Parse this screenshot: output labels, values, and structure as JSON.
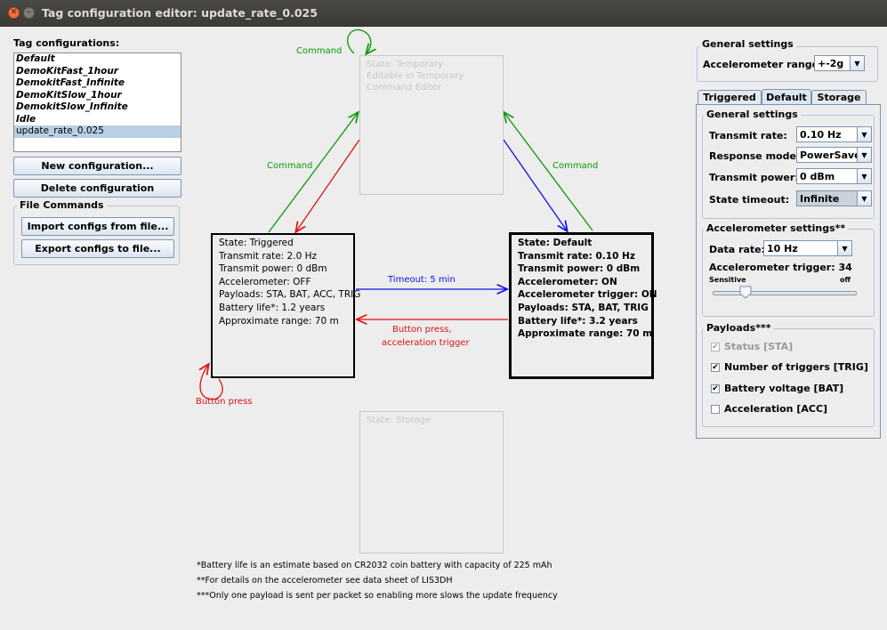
{
  "window": {
    "title": "Tag configuration editor: update_rate_0.025"
  },
  "left": {
    "list_label": "Tag configurations:",
    "configs": [
      "Default",
      "DemoKitFast_1hour",
      "DemokitFast_Infinite",
      "DemoKitSlow_1hour",
      "DemokitSlow_Infinite",
      "Idle",
      "update_rate_0.025"
    ],
    "selected_index": 6,
    "new_button": "New configuration...",
    "delete_button": "Delete configuration",
    "file_group": "File Commands",
    "import_button": "Import configs from file...",
    "export_button": "Export configs to file..."
  },
  "diagram": {
    "temporary": {
      "lines": [
        "State: Temporary",
        "Editable in Temporary",
        "Command Editor"
      ]
    },
    "triggered": {
      "lines": [
        "State: Triggered",
        "Transmit rate: 2.0 Hz",
        "Transmit power: 0 dBm",
        "Accelerometer: OFF",
        "Payloads: STA, BAT, ACC, TRIG",
        "Battery life*: 1.2 years",
        "Approximate range: 70 m"
      ]
    },
    "default": {
      "lines": [
        "State: Default",
        "Transmit rate: 0.10 Hz",
        "Transmit power: 0 dBm",
        "Accelerometer: ON",
        "Accelerometer trigger: ON",
        "Payloads: STA, BAT, TRIG",
        "Battery life*: 3.2 years",
        "Approximate range: 70 m"
      ]
    },
    "storage": {
      "lines": [
        "State: Storage"
      ]
    },
    "labels": {
      "command_top": "Command",
      "command_left": "Command",
      "command_right": "Command",
      "timeout": "Timeout: 5 min",
      "button_accel_1": "Button press,",
      "button_accel_2": "acceleration trigger",
      "button_press": "Button press"
    },
    "colors": {
      "command": "#0a9a0a",
      "button": "#e01010",
      "timeout": "#1010e8"
    }
  },
  "footnotes": [
    "*Battery life is an estimate based on CR2032 coin battery with capacity of 225 mAh",
    "**For details on the accelerometer see data sheet of LIS3DH",
    "***Only one payload is sent per packet so enabling more slows the update frequency"
  ],
  "right": {
    "general_title": "General settings",
    "accel_range_label": "Accelerometer range:",
    "accel_range_value": "+-2g",
    "tabs": [
      "Triggered",
      "Default",
      "Storage"
    ],
    "active_tab": "Default",
    "state_general_title": "General settings",
    "transmit_rate_label": "Transmit rate:",
    "transmit_rate_value": "0.10 Hz",
    "response_mode_label": "Response mode:",
    "response_mode_value": "PowerSave",
    "transmit_power_label": "Transmit power:",
    "transmit_power_value": "0 dBm",
    "state_timeout_label": "State timeout:",
    "state_timeout_value": "Infinite",
    "accel_settings_title": "Accelerometer settings**",
    "data_rate_label": "Data rate:",
    "data_rate_value": "10 Hz",
    "accel_trigger_label": "Accelerometer trigger: 34",
    "slider_left": "Sensitive",
    "slider_right": "off",
    "slider_fraction": 0.2,
    "payloads_title": "Payloads***",
    "payloads": [
      {
        "label": "Status [STA]",
        "checked": true,
        "enabled": false
      },
      {
        "label": "Number of triggers [TRIG]",
        "checked": true,
        "enabled": true
      },
      {
        "label": "Battery voltage [BAT]",
        "checked": true,
        "enabled": true
      },
      {
        "label": "Acceleration [ACC]",
        "checked": false,
        "enabled": true
      }
    ]
  }
}
